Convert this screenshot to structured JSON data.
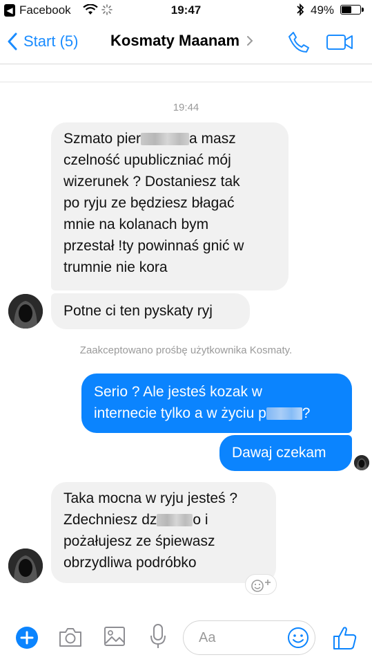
{
  "status_bar": {
    "back_app": "Facebook",
    "time": "19:47",
    "battery_percent": "49%",
    "battery_level": 0.49
  },
  "nav": {
    "back_label": "Start (5)",
    "title": "Kosmaty Maanam"
  },
  "conversation": {
    "timestamp": "19:44",
    "system_message": "Zaakceptowano prośbę użytkownika Kosmaty.",
    "messages": [
      {
        "direction": "in",
        "lines": [
          "Szmato pier",
          "a masz",
          "czelność upubliczniać mój",
          "wizerunek ? Dostaniesz tak",
          "po ryju ze będziesz błagać",
          "mnie na kolanach bym",
          "przestał !ty powinnaś gnić w",
          "trumnie nie kora"
        ]
      },
      {
        "direction": "in",
        "text": "Potne ci ten pyskaty ryj"
      },
      {
        "direction": "out",
        "lines": [
          "Serio ? Ale jesteś kozak w",
          "internecie tylko a w życiu p",
          "?"
        ]
      },
      {
        "direction": "out",
        "text": "Dawaj czekam"
      },
      {
        "direction": "in",
        "lines": [
          "Taka mocna w ryju jesteś ?",
          "Zdechniesz dz",
          "o i",
          "pożałujesz ze śpiewasz",
          "obrzydliwa podróbko"
        ]
      }
    ]
  },
  "composer": {
    "placeholder": "Aa"
  },
  "colors": {
    "accent": "#0b84fe",
    "nav_blue": "#1a8cff",
    "incoming_bubble": "#f1f1f1",
    "meta_text": "#9a9a9a"
  }
}
